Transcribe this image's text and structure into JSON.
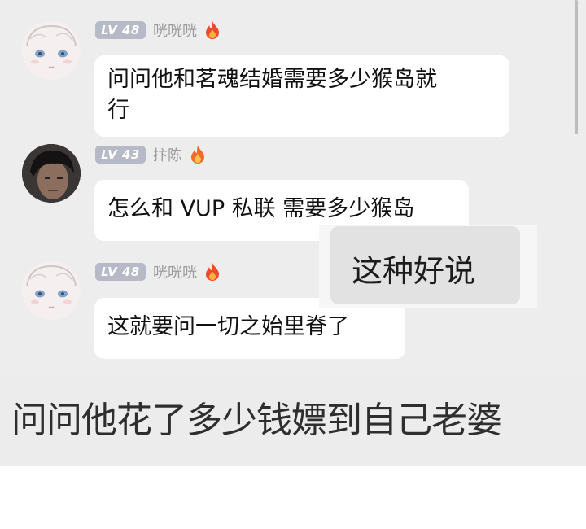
{
  "messages": [
    {
      "level": "LV 48",
      "nickname": "咣咣咣",
      "avatar": "anime-girl-avatar",
      "badge_icon": "fire-icon",
      "lines": [
        "问问他和茗魂结婚需要多少猴岛就",
        "行"
      ]
    },
    {
      "level": "LV 43",
      "nickname": "抃陈",
      "avatar": "man-photo-avatar",
      "badge_icon": "fire-icon",
      "lines": [
        "怎么和 VUP 私联 需要多少猴岛"
      ]
    },
    {
      "level": "LV 48",
      "nickname": "咣咣咣",
      "avatar": "anime-girl-avatar",
      "badge_icon": "fire-icon",
      "lines": [
        "这就要问一切之始里脊了"
      ]
    }
  ],
  "overlay_reply": "这种好说",
  "caption": "问问他花了多少钱嫖到自己老婆",
  "colors": {
    "chat_background": "#ededed",
    "bubble": "#ffffff",
    "level_badge": "#b6b9c6",
    "nickname": "#9a9a9a"
  }
}
